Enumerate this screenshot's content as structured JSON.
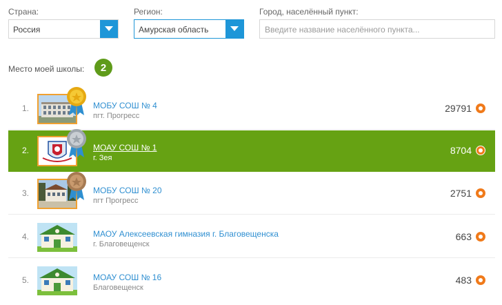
{
  "filters": {
    "country": {
      "label": "Страна:",
      "value": "Россия"
    },
    "region": {
      "label": "Регион:",
      "value": "Амурская область"
    },
    "city": {
      "label": "Город, населённый пункт:",
      "placeholder": "Введите название населённого пункта..."
    }
  },
  "my_place": {
    "label": "Место моей школы:",
    "value": "2"
  },
  "schools": [
    {
      "rank": "1.",
      "name": "МОБУ СОШ № 4",
      "city": "пгт. Прогресс",
      "score": "29791",
      "medal": "gold-medal-icon"
    },
    {
      "rank": "2.",
      "name": "МОАУ СОШ № 1",
      "city": "г. Зея",
      "score": "8704",
      "medal": "silver-medal-icon"
    },
    {
      "rank": "3.",
      "name": "МОБУ СОШ № 20",
      "city": "пгт Прогресс",
      "score": "2751",
      "medal": "bronze-medal-icon"
    },
    {
      "rank": "4.",
      "name": "МАОУ Алексеевская гимназия г. Благовещенска",
      "city": "г. Благовещенск",
      "score": "663"
    },
    {
      "rank": "5.",
      "name": "МОАУ СОШ № 16",
      "city": "Благовещенск",
      "score": "483"
    }
  ],
  "colors": {
    "accent": "#1e96d8",
    "highlight": "#66a213",
    "badge": "#5f9b1a",
    "coin": "#f07a1a"
  }
}
